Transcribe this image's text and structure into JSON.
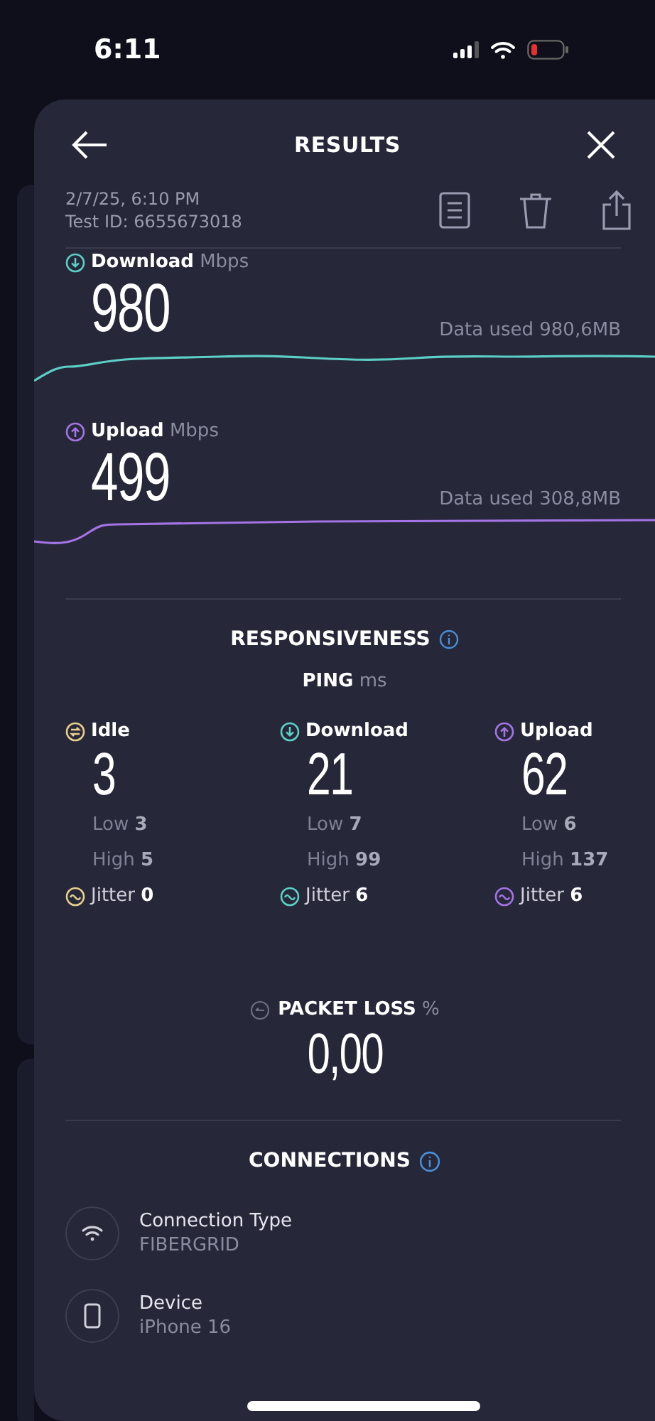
{
  "status_bar": {
    "time": "6:11"
  },
  "header": {
    "title": "RESULTS"
  },
  "meta": {
    "date": "2/7/25, 6:10 PM",
    "test_id": "Test ID: 6655673018"
  },
  "speeds": [
    {
      "kind": "download",
      "label": "Download",
      "unit": "Mbps",
      "value": "980",
      "data_used": "Data used 980,6MB",
      "color": "#5ccfc6"
    },
    {
      "kind": "upload",
      "label": "Upload",
      "unit": "Mbps",
      "value": "499",
      "data_used": "Data used 308,8MB",
      "color": "#a474e6"
    }
  ],
  "responsiveness": {
    "title": "RESPONSIVENESS",
    "ping_label": "PING",
    "ping_unit": "ms",
    "columns": [
      {
        "kind": "idle",
        "label": "Idle",
        "value": "3",
        "low_label": "Low",
        "low": "3",
        "high_label": "High",
        "high": "5",
        "jitter_label": "Jitter",
        "jitter": "0",
        "color": "#e6cf8c"
      },
      {
        "kind": "download",
        "label": "Download",
        "value": "21",
        "low_label": "Low",
        "low": "7",
        "high_label": "High",
        "high": "99",
        "jitter_label": "Jitter",
        "jitter": "6",
        "color": "#5ccfc6"
      },
      {
        "kind": "upload",
        "label": "Upload",
        "value": "62",
        "low_label": "Low",
        "low": "6",
        "high_label": "High",
        "high": "137",
        "jitter_label": "Jitter",
        "jitter": "6",
        "color": "#a474e6"
      }
    ]
  },
  "packet_loss": {
    "label": "PACKET LOSS",
    "unit": "%",
    "value": "0,00"
  },
  "connections": {
    "title": "CONNECTIONS",
    "items": [
      {
        "kind": "wifi",
        "label": "Connection Type",
        "value": "FIBERGRID"
      },
      {
        "kind": "device",
        "label": "Device",
        "value": "iPhone 16"
      }
    ]
  }
}
